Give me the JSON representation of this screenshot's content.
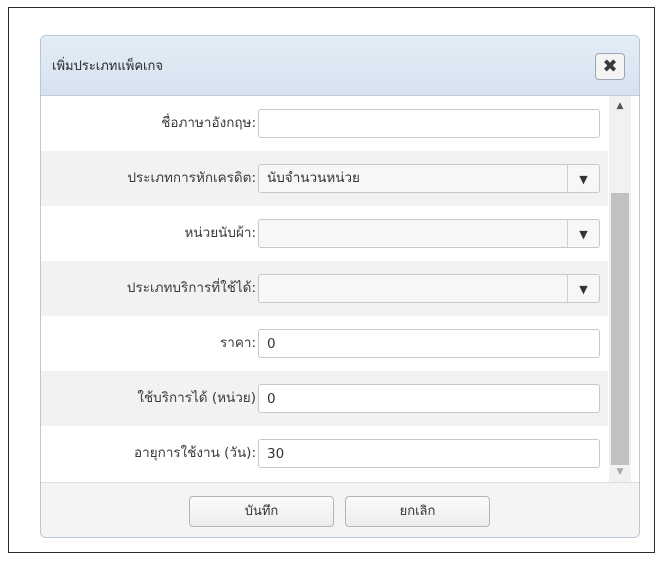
{
  "dialog": {
    "title": "เพิ่มประเภทแพ็คเกจ",
    "close_symbol": "✖"
  },
  "form": {
    "english_name": {
      "label": "ชื่อภาษาอังกฤษ:",
      "value": ""
    },
    "credit_deduction_type": {
      "label": "ประเภทการหักเครดิต:",
      "value": "นับจำนวนหน่วย"
    },
    "cloth_unit": {
      "label": "หน่วยนับผ้า:",
      "value": ""
    },
    "service_type": {
      "label": "ประเภทบริการที่ใช้ได้:",
      "value": ""
    },
    "price": {
      "label": "ราคา:",
      "value": "0"
    },
    "usable_service_units": {
      "label": "ใช้บริการได้ (หน่วย)",
      "value": "0"
    },
    "duration_days": {
      "label": "อายุการใช้งาน (วัน):",
      "value": "30"
    }
  },
  "buttons": {
    "save": "บันทึก",
    "cancel": "ยกเลิก"
  },
  "icons": {
    "close": "close-icon",
    "dropdown": "chevron-down-icon",
    "scroll_up": "arrow-up-icon",
    "scroll_down": "arrow-down-icon"
  },
  "colors": {
    "titlebar": "#dce7f2",
    "row_alt": "#f2f2f2",
    "scroll_thumb": "#c1c1c1"
  }
}
